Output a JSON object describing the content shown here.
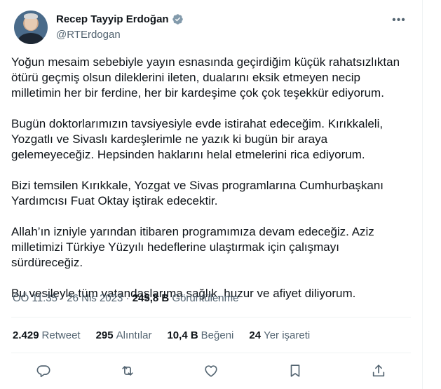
{
  "tweet": {
    "author_name": "Recep Tayyip Erdoğan",
    "author_handle": "@RTErdogan",
    "paragraphs": [
      "Yoğun mesaim sebebiyle yayın esnasında geçirdiğim küçük rahatsızlıktan ötürü geçmiş olsun dileklerini ileten, dualarını eksik etmeyen necip milletimin her bir ferdine, her bir kardeşime çok çok teşekkür ediyorum.",
      "Bugün doktorlarımızın tavsiyesiyle evde istirahat edeceğim. Kırıkkaleli, Yozgatlı ve Sivaslı kardeşlerimle ne yazık ki bugün bir araya gelemeyeceğiz. Hepsinden haklarını helal etmelerini rica ediyorum.",
      "Bizi temsilen Kırıkkale, Yozgat ve Sivas programlarına Cumhurbaşkanı Yardımcısı Fuat Oktay iştirak edecektir.",
      "Allah’ın izniyle yarından itibaren programımıza devam edeceğiz. Aziz milletimizi Türkiye Yüzyılı hedeflerine ulaştırmak için çalışmayı sürdüreceğiz.",
      "Bu vesileyle tüm vatandaşlarıma sağlık, huzur ve afiyet diliyorum."
    ],
    "time": "ÖÖ 11:35",
    "date": "26 Nis 2023",
    "views_count": "245,8 B",
    "views_label": "Görüntülenme",
    "separator": "·"
  },
  "stats": [
    {
      "count": "2.429",
      "label": "Retweet"
    },
    {
      "count": "295",
      "label": "Alıntılar"
    },
    {
      "count": "10,4 B",
      "label": "Beğeni"
    },
    {
      "count": "24",
      "label": "Yer işareti"
    }
  ],
  "actions": [
    "reply-icon",
    "retweet-icon",
    "like-icon",
    "bookmark-icon",
    "share-icon"
  ],
  "colors": {
    "verified": "#829aab",
    "muted": "#536471",
    "text": "#0f1419",
    "divider": "#eff3f4"
  }
}
